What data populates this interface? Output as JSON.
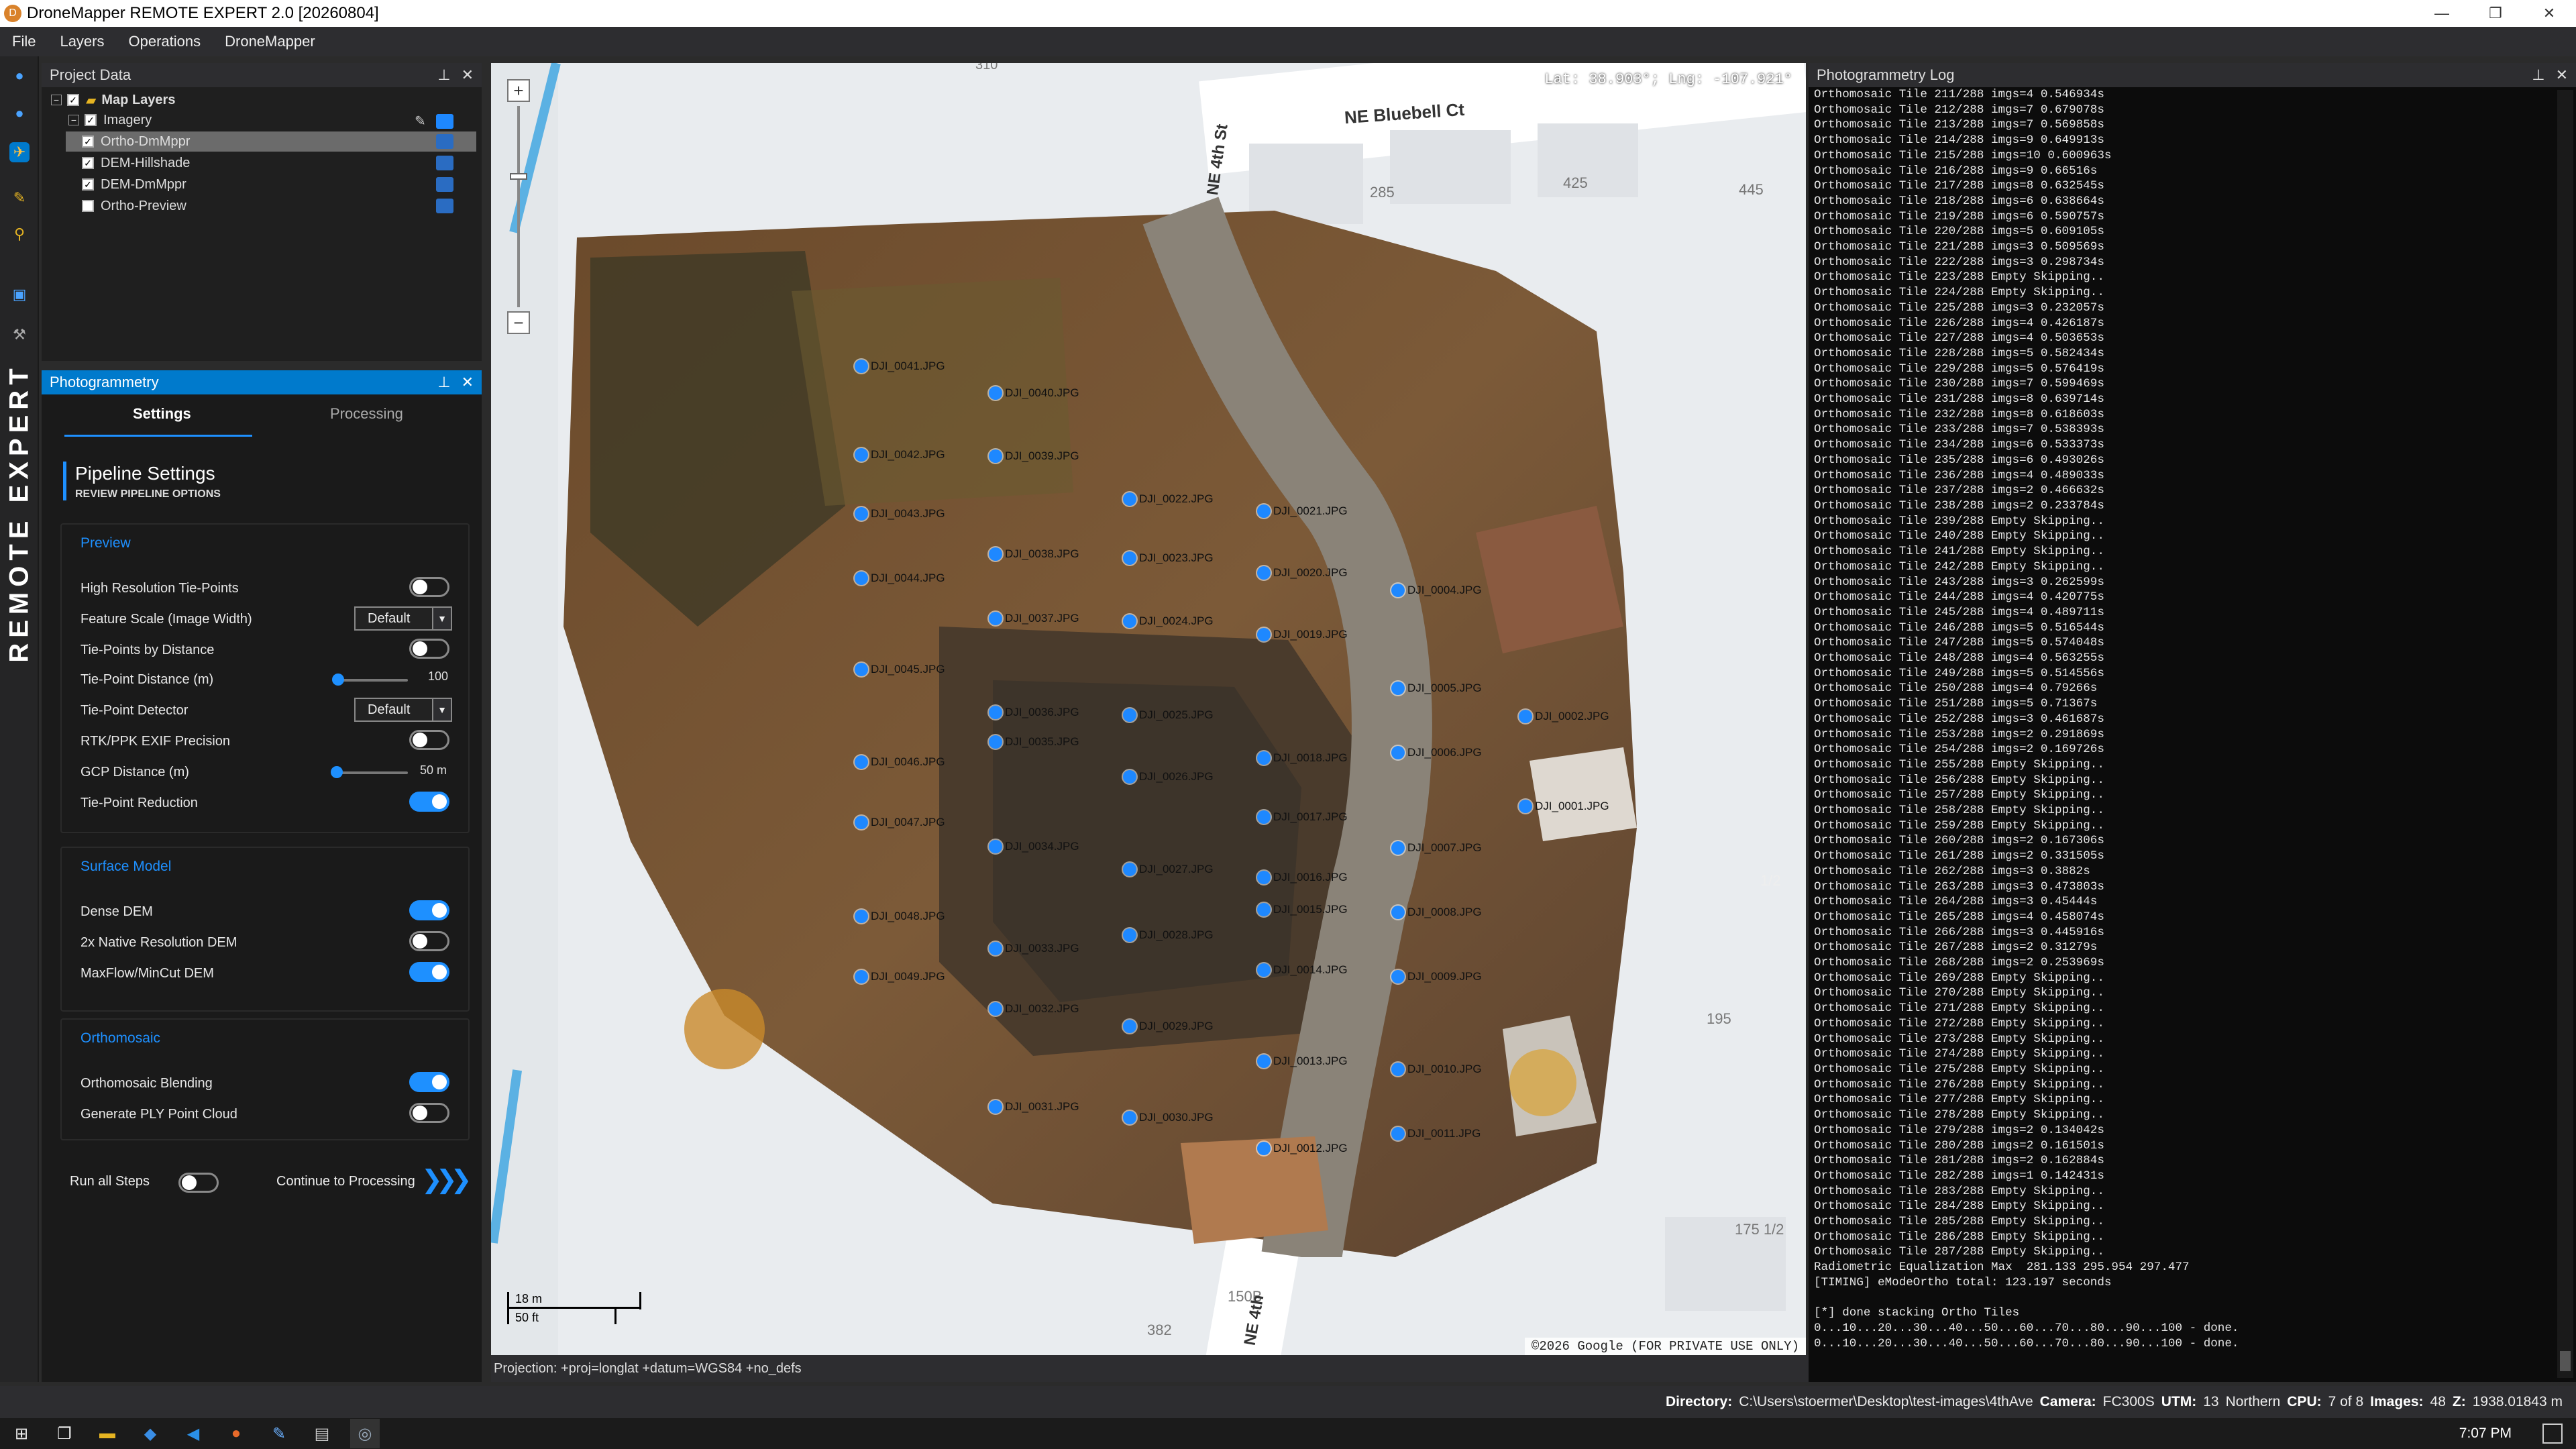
{
  "window": {
    "title": "DroneMapper REMOTE EXPERT 2.0 [20260804]",
    "minimize": "—",
    "restore": "❐",
    "close": "✕"
  },
  "menu": [
    "File",
    "Layers",
    "Operations",
    "DroneMapper"
  ],
  "brand": "REMOTE EXPERT",
  "project_data": {
    "title": "Project Data",
    "items": [
      {
        "label": "Map Layers",
        "checked": true
      },
      {
        "label": "Imagery",
        "checked": true
      },
      {
        "label": "Ortho-DmMppr",
        "checked": true
      },
      {
        "label": "DEM-Hillshade",
        "checked": true
      },
      {
        "label": "DEM-DmMppr",
        "checked": true
      },
      {
        "label": "Ortho-Preview",
        "checked": false
      }
    ]
  },
  "photogrammetry": {
    "title": "Photogrammetry",
    "tabs": [
      "Settings",
      "Processing"
    ],
    "heading": "Pipeline Settings",
    "subheading": "REVIEW PIPELINE OPTIONS",
    "sections": {
      "preview": "Preview",
      "surface": "Surface Model",
      "ortho": "Orthomosaic"
    },
    "rows": {
      "high_res": {
        "label": "High Resolution Tie-Points",
        "on": false
      },
      "feature_scale": {
        "label": "Feature Scale (Image Width)",
        "value": "Default"
      },
      "tie_dist": {
        "label": "Tie-Points by Distance",
        "on": false
      },
      "tie_dist_m": {
        "label": "Tie-Point Distance (m)",
        "value": "100",
        "level": 0.05
      },
      "detector": {
        "label": "Tie-Point Detector",
        "value": "Default"
      },
      "rtk": {
        "label": "RTK/PPK EXIF Precision",
        "on": false
      },
      "gcp": {
        "label": "GCP Distance (m)",
        "value": "50 m",
        "level": 0.04
      },
      "reduction": {
        "label": "Tie-Point Reduction",
        "on": true
      },
      "dense_dem": {
        "label": "Dense DEM",
        "on": true
      },
      "native_dem": {
        "label": "2x Native Resolution DEM",
        "on": false
      },
      "maxflow": {
        "label": "MaxFlow/MinCut DEM",
        "on": true
      },
      "blending": {
        "label": "Orthomosaic Blending",
        "on": true
      },
      "ply": {
        "label": "Generate PLY Point Cloud",
        "on": false
      }
    },
    "run_all": {
      "label": "Run all Steps",
      "on": false
    },
    "continue": "Continue to Processing"
  },
  "map": {
    "coords": "Lat: 38.903°; Lng: -107.921°",
    "attribution": "©2026 Google (FOR PRIVATE USE ONLY)",
    "scale_m": "18 m",
    "scale_ft": "50 ft",
    "street_labels": [
      "NE Bluebell Ct",
      "NE 4th St",
      "NE 4th"
    ],
    "lot_numbers": [
      "310",
      "285",
      "425",
      "445",
      "195",
      "175 1/2",
      "150B",
      "382",
      "1/2"
    ],
    "pins": [
      "DJI_0041.JPG",
      "DJI_0040.JPG",
      "DJI_0042.JPG",
      "DJI_0039.JPG",
      "DJI_0043.JPG",
      "DJI_0022.JPG",
      "DJI_0021.JPG",
      "DJI_0038.JPG",
      "DJI_0023.JPG",
      "DJI_0044.JPG",
      "DJI_0020.JPG",
      "DJI_0004.JPG",
      "DJI_0037.JPG",
      "DJI_0024.JPG",
      "DJI_0019.JPG",
      "DJI_0045.JPG",
      "DJI_0005.JPG",
      "DJI_0036.JPG",
      "DJI_0025.JPG",
      "DJI_0002.JPG",
      "DJI_0035.JPG",
      "DJI_0018.JPG",
      "DJI_0006.JPG",
      "DJI_0046.JPG",
      "DJI_0026.JPG",
      "DJI_0001.JPG",
      "DJI_0047.JPG",
      "DJI_0017.JPG",
      "DJI_0034.JPG",
      "DJI_0007.JPG",
      "DJI_0027.JPG",
      "DJI_0016.JPG",
      "DJI_0048.JPG",
      "DJI_0015.JPG",
      "DJI_0008.JPG",
      "DJI_0028.JPG",
      "DJI_0033.JPG",
      "DJI_0014.JPG",
      "DJI_0049.JPG",
      "DJI_0009.JPG",
      "DJI_0032.JPG",
      "DJI_0029.JPG",
      "DJI_0013.JPG",
      "DJI_0010.JPG",
      "DJI_0031.JPG",
      "DJI_0030.JPG",
      "DJI_0011.JPG",
      "DJI_0012.JPG"
    ]
  },
  "projection": "Projection: +proj=longlat +datum=WGS84 +no_defs",
  "log": {
    "title": "Photogrammetry Log",
    "text": "Orthomosaic Tile 211/288 imgs=4 0.546934s\nOrthomosaic Tile 212/288 imgs=7 0.679078s\nOrthomosaic Tile 213/288 imgs=7 0.569858s\nOrthomosaic Tile 214/288 imgs=9 0.649913s\nOrthomosaic Tile 215/288 imgs=10 0.600963s\nOrthomosaic Tile 216/288 imgs=9 0.66516s\nOrthomosaic Tile 217/288 imgs=8 0.632545s\nOrthomosaic Tile 218/288 imgs=6 0.638664s\nOrthomosaic Tile 219/288 imgs=6 0.590757s\nOrthomosaic Tile 220/288 imgs=5 0.609105s\nOrthomosaic Tile 221/288 imgs=3 0.509569s\nOrthomosaic Tile 222/288 imgs=3 0.298734s\nOrthomosaic Tile 223/288 Empty Skipping..\nOrthomosaic Tile 224/288 Empty Skipping..\nOrthomosaic Tile 225/288 imgs=3 0.232057s\nOrthomosaic Tile 226/288 imgs=4 0.426187s\nOrthomosaic Tile 227/288 imgs=4 0.503653s\nOrthomosaic Tile 228/288 imgs=5 0.582434s\nOrthomosaic Tile 229/288 imgs=5 0.576419s\nOrthomosaic Tile 230/288 imgs=7 0.599469s\nOrthomosaic Tile 231/288 imgs=8 0.639714s\nOrthomosaic Tile 232/288 imgs=8 0.618603s\nOrthomosaic Tile 233/288 imgs=7 0.538393s\nOrthomosaic Tile 234/288 imgs=6 0.533373s\nOrthomosaic Tile 235/288 imgs=6 0.493026s\nOrthomosaic Tile 236/288 imgs=4 0.489033s\nOrthomosaic Tile 237/288 imgs=2 0.466632s\nOrthomosaic Tile 238/288 imgs=2 0.233784s\nOrthomosaic Tile 239/288 Empty Skipping..\nOrthomosaic Tile 240/288 Empty Skipping..\nOrthomosaic Tile 241/288 Empty Skipping..\nOrthomosaic Tile 242/288 Empty Skipping..\nOrthomosaic Tile 243/288 imgs=3 0.262599s\nOrthomosaic Tile 244/288 imgs=4 0.420775s\nOrthomosaic Tile 245/288 imgs=4 0.489711s\nOrthomosaic Tile 246/288 imgs=5 0.516544s\nOrthomosaic Tile 247/288 imgs=5 0.574048s\nOrthomosaic Tile 248/288 imgs=4 0.563255s\nOrthomosaic Tile 249/288 imgs=5 0.514556s\nOrthomosaic Tile 250/288 imgs=4 0.79266s\nOrthomosaic Tile 251/288 imgs=5 0.71367s\nOrthomosaic Tile 252/288 imgs=3 0.461687s\nOrthomosaic Tile 253/288 imgs=2 0.291869s\nOrthomosaic Tile 254/288 imgs=2 0.169726s\nOrthomosaic Tile 255/288 Empty Skipping..\nOrthomosaic Tile 256/288 Empty Skipping..\nOrthomosaic Tile 257/288 Empty Skipping..\nOrthomosaic Tile 258/288 Empty Skipping..\nOrthomosaic Tile 259/288 Empty Skipping..\nOrthomosaic Tile 260/288 imgs=2 0.167306s\nOrthomosaic Tile 261/288 imgs=2 0.331505s\nOrthomosaic Tile 262/288 imgs=3 0.3882s\nOrthomosaic Tile 263/288 imgs=3 0.473803s\nOrthomosaic Tile 264/288 imgs=3 0.45444s\nOrthomosaic Tile 265/288 imgs=4 0.458074s\nOrthomosaic Tile 266/288 imgs=3 0.445916s\nOrthomosaic Tile 267/288 imgs=2 0.31279s\nOrthomosaic Tile 268/288 imgs=2 0.253969s\nOrthomosaic Tile 269/288 Empty Skipping..\nOrthomosaic Tile 270/288 Empty Skipping..\nOrthomosaic Tile 271/288 Empty Skipping..\nOrthomosaic Tile 272/288 Empty Skipping..\nOrthomosaic Tile 273/288 Empty Skipping..\nOrthomosaic Tile 274/288 Empty Skipping..\nOrthomosaic Tile 275/288 Empty Skipping..\nOrthomosaic Tile 276/288 Empty Skipping..\nOrthomosaic Tile 277/288 Empty Skipping..\nOrthomosaic Tile 278/288 Empty Skipping..\nOrthomosaic Tile 279/288 imgs=2 0.134042s\nOrthomosaic Tile 280/288 imgs=2 0.161501s\nOrthomosaic Tile 281/288 imgs=2 0.162884s\nOrthomosaic Tile 282/288 imgs=1 0.142431s\nOrthomosaic Tile 283/288 Empty Skipping..\nOrthomosaic Tile 284/288 Empty Skipping..\nOrthomosaic Tile 285/288 Empty Skipping..\nOrthomosaic Tile 286/288 Empty Skipping..\nOrthomosaic Tile 287/288 Empty Skipping..\nRadiometric Equalization Max  281.133 295.954 297.477\n[TIMING] eModeOrtho total: 123.197 seconds\n\n[*] done stacking Ortho Tiles\n0...10...20...30...40...50...60...70...80...90...100 - done.\n0...10...20...30...40...50...60...70...80...90...100 - done."
  },
  "status": {
    "directory_label": "Directory:",
    "directory": "C:\\Users\\stoermer\\Desktop\\test-images\\4thAve",
    "camera_label": "Camera:",
    "camera": "FC300S",
    "utm_label": "UTM:",
    "utm": "13",
    "hemisphere": "Northern",
    "cpu_label": "CPU:",
    "cpu": "7 of 8",
    "images_label": "Images:",
    "images": "48",
    "z_label": "Z:",
    "z": "1938.01843 m"
  },
  "clock": "7:07 PM",
  "colors": {
    "accent": "#007acc",
    "toggle_on": "#1e90ff",
    "pin": "#1e88ff"
  }
}
